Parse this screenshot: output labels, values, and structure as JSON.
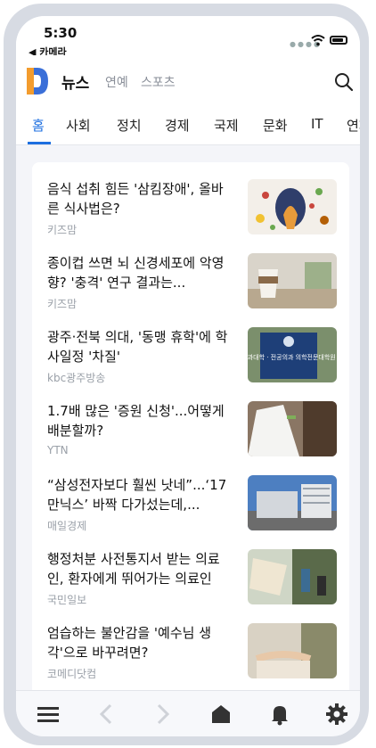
{
  "status": {
    "time": "5:30",
    "back_label": "◀ 카메라"
  },
  "header": {
    "logo_letter": "D",
    "title": "뉴스",
    "tab_entertainment": "연예",
    "tab_sports": "스포츠"
  },
  "categories": [
    "홈",
    "사회",
    "정치",
    "경제",
    "국제",
    "문화",
    "IT",
    "연재"
  ],
  "articles": [
    {
      "title": "음식 섭취 힘든 '삼킴장애', 올바른 식사법은?",
      "source": "키즈맘"
    },
    {
      "title": "종이컵 쓰면 뇌 신경세포에 악영향? '충격' 연구 결과는...",
      "source": "키즈맘"
    },
    {
      "title": "광주·전북 의대, '동맹 휴학'에 학사일정 '차질'",
      "source": "kbc광주방송"
    },
    {
      "title": "1.7배 많은 '증원 신청'...어떻게 배분할까?",
      "source": "YTN"
    },
    {
      "title": "“삼성전자보다 훨씬 낫네”...‘17만닉스’ 바짝 다가섰는데,...",
      "source": "매일경제"
    },
    {
      "title": "행정처분 사전통지서 받는 의료인, 환자에게 뛰어가는 의료인",
      "source": "국민일보"
    },
    {
      "title": "엄습하는 불안감을 '예수님 생각'으로 바꾸려면?",
      "source": "코메디닷컴"
    }
  ],
  "thumb_sign_text": "의과대학 · 전공의과 의학전문대학원",
  "colors": {
    "accent": "#1d6fe0",
    "logo_orange": "#f39c2d",
    "logo_blue": "#3a6fd8"
  }
}
